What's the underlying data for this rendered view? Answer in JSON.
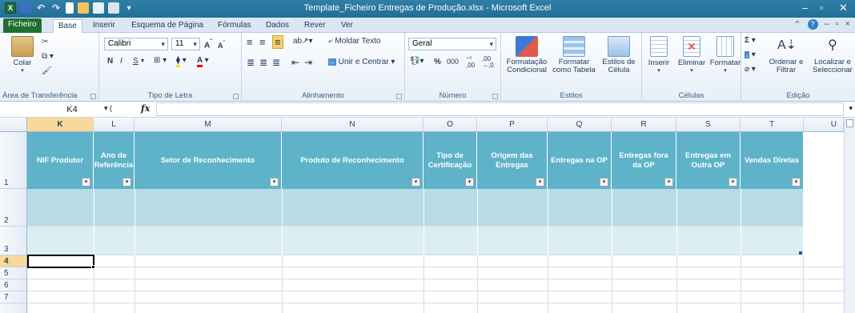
{
  "window": {
    "title": "Template_Ficheiro Entregas de Produção.xlsx - Microsoft Excel",
    "minimize": "–",
    "maximize": "▫",
    "close": "✕"
  },
  "ribbon_tabs": {
    "file": "Ficheiro",
    "home": "Base",
    "insert": "Inserir",
    "page_layout": "Esquema de Página",
    "formulas": "Fórmulas",
    "data": "Dados",
    "review": "Rever",
    "view": "Ver"
  },
  "clipboard": {
    "paste": "Colar",
    "label": "Área de Transferência"
  },
  "font": {
    "name": "Calibri",
    "size": "11",
    "bold": "N",
    "italic": "I",
    "underline": "S",
    "label": "Tipo de Letra"
  },
  "alignment": {
    "wrap_text": "Moldar Texto",
    "merge_center": "Unir e Centrar",
    "label": "Alinhamento"
  },
  "number": {
    "format": "Geral",
    "percent": "%",
    "thousands": "000",
    "label": "Número"
  },
  "styles": {
    "conditional": "Formatação Condicional",
    "format_table": "Formatar como Tabela",
    "cell_styles": "Estilos de Célula",
    "label": "Estilos"
  },
  "cells": {
    "insert": "Inserir",
    "delete": "Eliminar",
    "format": "Formatar",
    "label": "Células"
  },
  "editing": {
    "sort_filter": "Ordenar e Filtrar",
    "find_select": "Localizar e Seleccionar",
    "label": "Edição"
  },
  "formula_bar": {
    "name_box": "K4",
    "fx": "fx",
    "value": ""
  },
  "columns": [
    "K",
    "L",
    "M",
    "N",
    "O",
    "P",
    "Q",
    "R",
    "S",
    "T",
    "U"
  ],
  "rows": [
    "1",
    "2",
    "3",
    "4",
    "5",
    "6",
    "7"
  ],
  "table_headers": [
    "NIF Produtor",
    "Ano de Referência",
    "Setor de Reconhecimento",
    "Produto de Reconhecimento",
    "Tipo de Certificação",
    "Origem das Entregas",
    "Entregas na OP",
    "Entregas fora da OP",
    "Entregas em Outra OP",
    "Vendas Diretas"
  ],
  "colors": {
    "header_fill": "#5fb3c9",
    "row_band_1": "#b7dce6",
    "row_band_2": "#daeef3",
    "title_bar": "#2a76a0",
    "file_tab": "#1f6f2f"
  }
}
